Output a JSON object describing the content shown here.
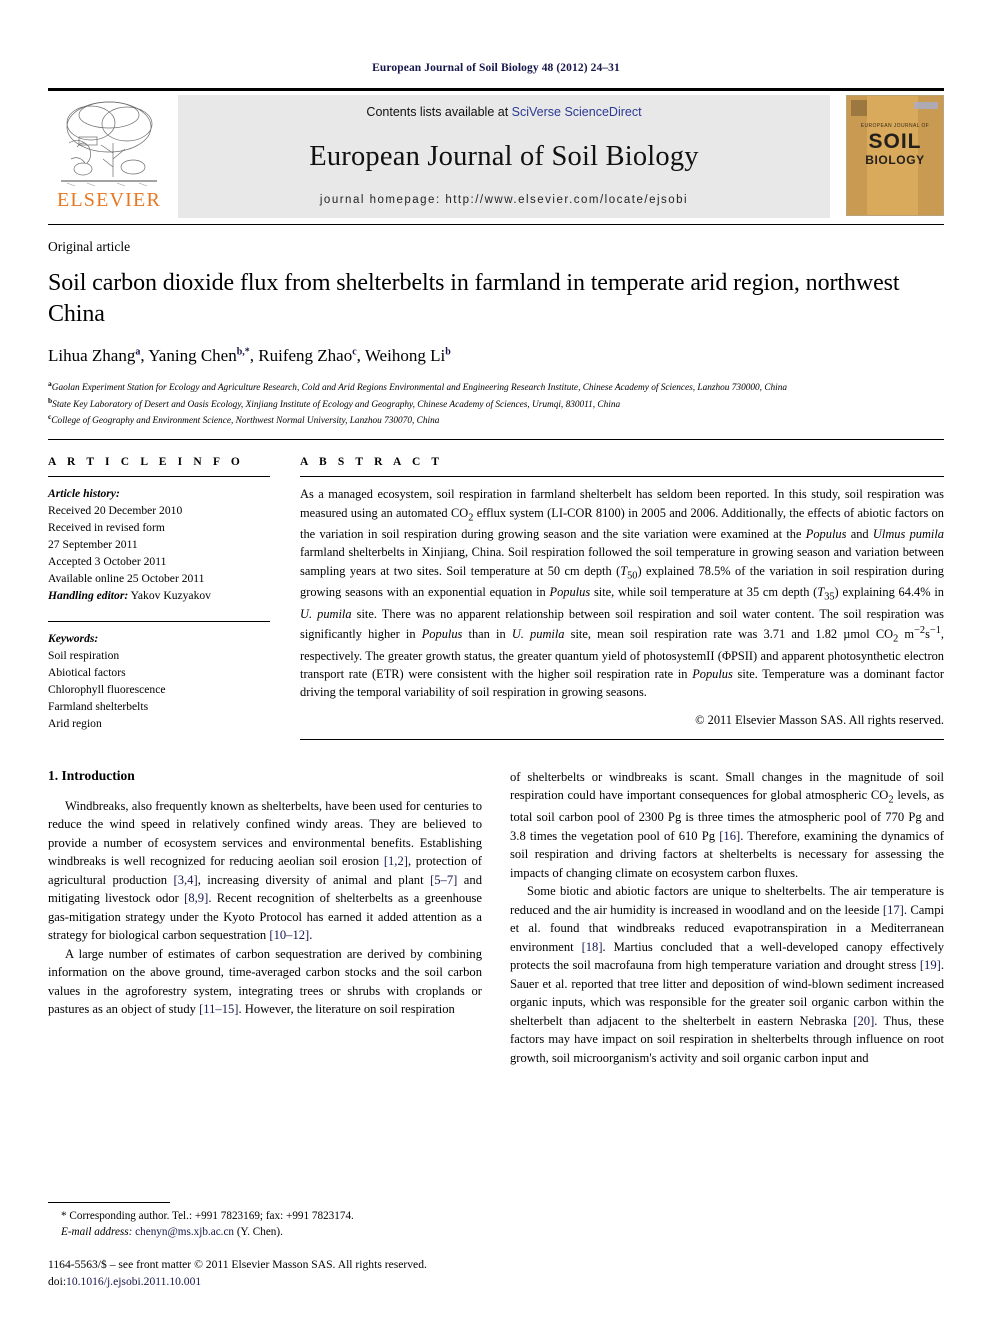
{
  "running_head": "European Journal of Soil Biology 48 (2012) 24–31",
  "masthead": {
    "publisher_name": "ELSEVIER",
    "contents_prefix": "Contents lists available at ",
    "sciencedirect_link": "SciVerse ScienceDirect",
    "journal_name": "European Journal of Soil Biology",
    "homepage_line": "journal homepage: http://www.elsevier.com/locate/ejsobi",
    "cover": {
      "eyebrow": "EUROPEAN JOURNAL OF",
      "title_line1": "SOIL",
      "title_line2": "BIOLOGY"
    }
  },
  "article": {
    "type": "Original article",
    "title": "Soil carbon dioxide flux from shelterbelts in farmland in temperate arid region, northwest China",
    "authors": [
      {
        "name": "Lihua Zhang",
        "marks": "a"
      },
      {
        "name": "Yaning Chen",
        "marks": "b,*"
      },
      {
        "name": "Ruifeng Zhao",
        "marks": "c"
      },
      {
        "name": "Weihong Li",
        "marks": "b"
      }
    ],
    "affiliations": [
      {
        "mark": "a",
        "text": "Gaolan Experiment Station for Ecology and Agriculture Research, Cold and Arid Regions Environmental and Engineering Research Institute, Chinese Academy of Sciences, Lanzhou 730000, China"
      },
      {
        "mark": "b",
        "text": "State Key Laboratory of Desert and Oasis Ecology, Xinjiang Institute of Ecology and Geography, Chinese Academy of Sciences, Urumqi, 830011, China"
      },
      {
        "mark": "c",
        "text": "College of Geography and Environment Science, Northwest Normal University, Lanzhou 730070, China"
      }
    ]
  },
  "article_info": {
    "heading": "A R T I C L E   I N F O",
    "history_label": "Article history:",
    "history": [
      "Received 20 December 2010",
      "Received in revised form",
      "27 September 2011",
      "Accepted 3 October 2011",
      "Available online 25 October 2011"
    ],
    "handling_editor_label": "Handling editor:",
    "handling_editor": " Yakov Kuzyakov",
    "keywords_label": "Keywords:",
    "keywords": [
      "Soil respiration",
      "Abiotical factors",
      "Chlorophyll fluorescence",
      "Farmland shelterbelts",
      "Arid region"
    ]
  },
  "abstract": {
    "heading": "A B S T R A C T",
    "copyright": "© 2011 Elsevier Masson SAS. All rights reserved."
  },
  "sections": {
    "intro_heading": "1. Introduction"
  },
  "footnotes": {
    "corresponding": "* Corresponding author. Tel.: +991 7823169; fax: +991 7823174.",
    "email_label": "E-mail address:",
    "email": "chenyn@ms.xjb.ac.cn",
    "email_suffix": " (Y. Chen).",
    "issn_line": "1164-5563/$ – see front matter © 2011 Elsevier Masson SAS. All rights reserved.",
    "doi_label": "doi:",
    "doi": "10.1016/j.ejsobi.2011.10.001"
  },
  "colors": {
    "elsevier_orange": "#E87722",
    "link_blue": "#2b3a94",
    "reference_navy": "#16174a"
  }
}
